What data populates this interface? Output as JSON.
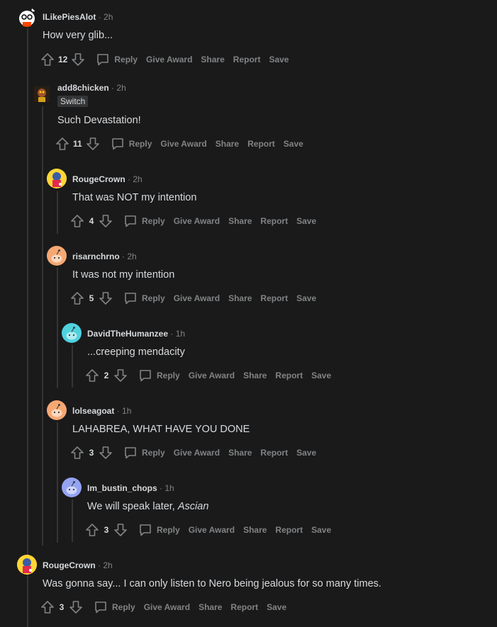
{
  "comments": [
    {
      "username": "ILikePiesAlot",
      "time": "2h",
      "body": "How very glib...",
      "score": "12",
      "flair": "",
      "avatar": "snoo-glasses"
    },
    {
      "username": "add8chicken",
      "time": "2h",
      "body": "Such Devastation!",
      "score": "11",
      "flair": "Switch",
      "avatar": "custom-dark"
    },
    {
      "username": "RougeCrown",
      "time": "2h",
      "body": "That was NOT my intention",
      "score": "4",
      "flair": "",
      "avatar": "yellow-figure"
    },
    {
      "username": "risarnchrno",
      "time": "2h",
      "body": "It was not my intention",
      "score": "5",
      "flair": "",
      "avatar": "snoo-orange"
    },
    {
      "username": "DavidTheHumanzee",
      "time": "1h",
      "body": "...creeping mendacity",
      "score": "2",
      "flair": "",
      "avatar": "snoo-teal"
    },
    {
      "username": "lolseagoat",
      "time": "1h",
      "body": "LAHABREA, WHAT HAVE YOU DONE",
      "score": "3",
      "flair": "",
      "avatar": "snoo-orange"
    },
    {
      "username": "Im_bustin_chops",
      "time": "1h",
      "body_prefix": "We will speak later, ",
      "body_em": "Ascian",
      "score": "3",
      "flair": "",
      "avatar": "snoo-blue"
    },
    {
      "username": "RougeCrown",
      "time": "2h",
      "body": "Was gonna say... I can only listen to Nero being jealous for so many times.",
      "score": "3",
      "flair": "",
      "avatar": "yellow-figure"
    }
  ],
  "actions": {
    "reply": "Reply",
    "give_award": "Give Award",
    "share": "Share",
    "report": "Report",
    "save": "Save"
  },
  "separator": "·"
}
